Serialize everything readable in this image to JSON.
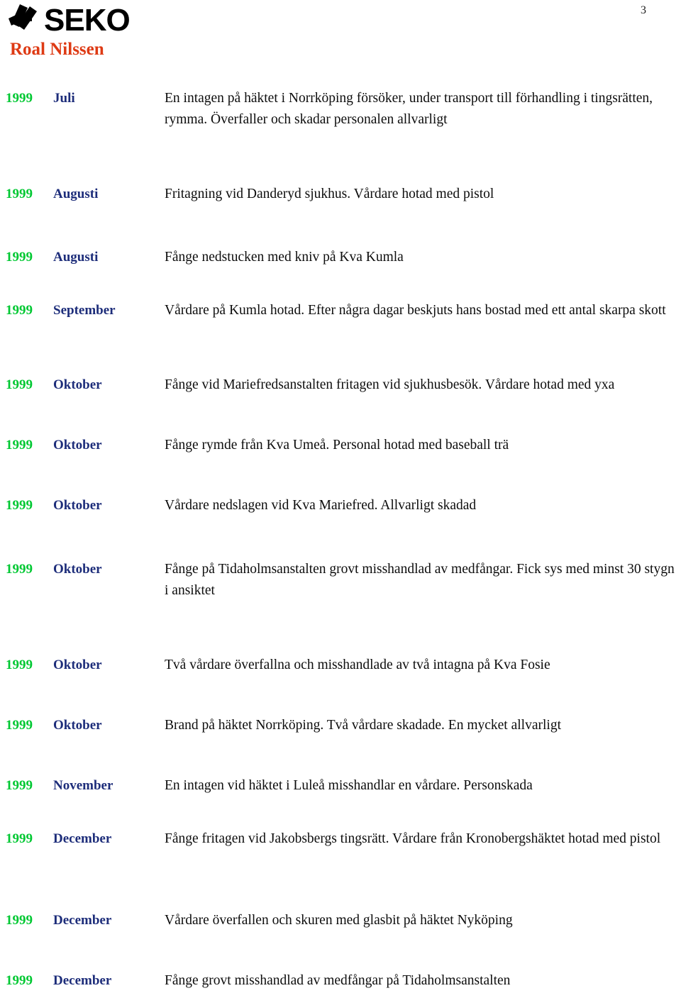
{
  "header": {
    "logo_text": "SEKO",
    "logo_mark_name": "seko-pinwheel-mark",
    "owner_name": "Roal Nilssen",
    "page_number": "3"
  },
  "incidents": [
    {
      "year": "1999",
      "month": "Juli",
      "description": "En intagen på häktet i Norrköping försöker, under transport till förhandling i tingsrätten, rymma. Överfaller och skadar personalen allvarligt"
    },
    {
      "year": "1999",
      "month": "Augusti",
      "description": "Fritagning vid Danderyd sjukhus. Vårdare hotad med pistol"
    },
    {
      "year": "1999",
      "month": "Augusti",
      "description": "Fånge nedstucken med kniv på Kva Kumla"
    },
    {
      "year": "1999",
      "month": "September",
      "description": "Vårdare på Kumla hotad. Efter några dagar beskjuts hans bostad med ett antal skarpa skott"
    },
    {
      "year": "1999",
      "month": "Oktober",
      "description": "Fånge vid Mariefredsanstalten fritagen vid sjukhusbesök. Vårdare hotad med yxa"
    },
    {
      "year": "1999",
      "month": "Oktober",
      "description": "Fånge rymde från Kva Umeå. Personal hotad med baseball trä"
    },
    {
      "year": "1999",
      "month": "Oktober",
      "description": "Vårdare nedslagen vid Kva Mariefred. Allvarligt skadad"
    },
    {
      "year": "1999",
      "month": "Oktober",
      "description": "Fånge på Tidaholmsanstalten grovt misshandlad av medfångar. Fick sys med minst 30 stygn i ansiktet"
    },
    {
      "year": "1999",
      "month": "Oktober",
      "description": "Två vårdare överfallna och misshandlade av två intagna på Kva Fosie"
    },
    {
      "year": "1999",
      "month": "Oktober",
      "description": "Brand på häktet Norrköping. Två vårdare skadade. En mycket allvarligt"
    },
    {
      "year": "1999",
      "month": "November",
      "description": "En intagen vid häktet i Luleå misshandlar en vårdare. Personskada"
    },
    {
      "year": "1999",
      "month": "December",
      "description": "Fånge fritagen vid Jakobsbergs tingsrätt. Vårdare från Kronobergshäktet hotad med pistol"
    },
    {
      "year": "1999",
      "month": "December",
      "description": "Vårdare överfallen och skuren med glasbit på häktet Nyköping"
    },
    {
      "year": "1999",
      "month": "December",
      "description": "Fånge grovt misshandlad av medfångar på Tidaholmsanstalten"
    }
  ],
  "layout": {
    "row_tops": [
      16,
      151,
      240,
      315,
      420,
      505,
      590,
      680,
      815,
      900,
      985,
      1060,
      1175,
      1260
    ],
    "desc_widths": [
      718,
      718,
      718,
      700,
      720,
      718,
      718,
      700,
      718,
      718,
      718,
      700,
      718,
      718
    ]
  },
  "colors": {
    "year": "#00C832",
    "month": "#1D2D7A",
    "owner": "#DE3A14",
    "body": "#0d0d0d"
  }
}
